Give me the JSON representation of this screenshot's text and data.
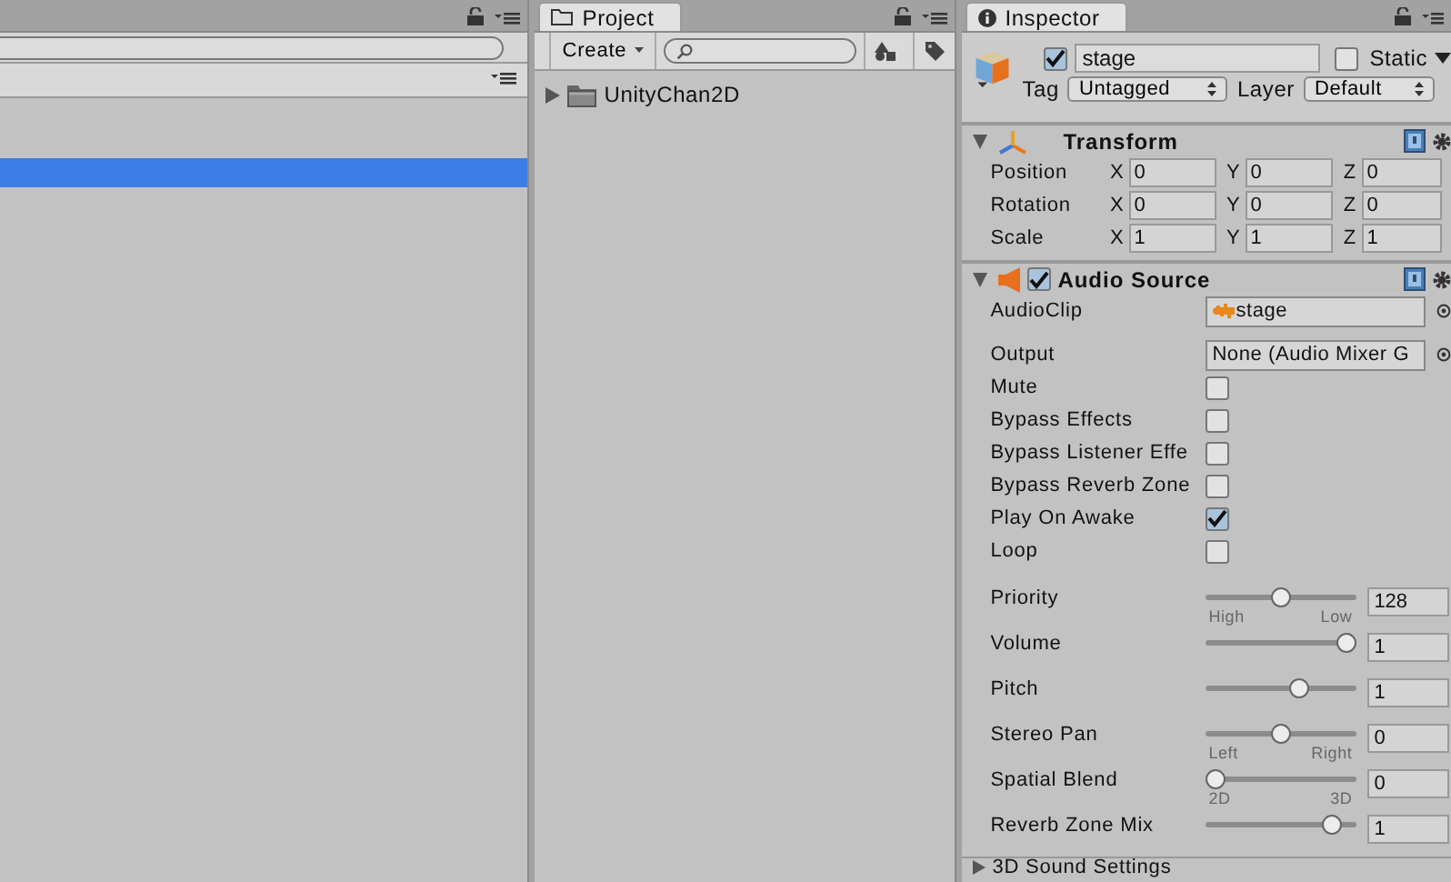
{
  "hierarchy": {
    "rows": [
      {
        "selected": true
      }
    ]
  },
  "project": {
    "tab": "Project",
    "create": "Create",
    "tree": [
      {
        "label": "UnityChan2D",
        "expanded": false
      }
    ]
  },
  "inspector": {
    "tab": "Inspector",
    "object": {
      "active": true,
      "name": "stage",
      "static": false,
      "static_label": "Static",
      "tag_label": "Tag",
      "tag": "Untagged",
      "layer_label": "Layer",
      "layer": "Default"
    },
    "components": [
      {
        "kind": "transform",
        "title": "Transform",
        "expanded": true,
        "rows": [
          {
            "label": "Position",
            "values": [
              {
                "axis": "X",
                "value": "0"
              },
              {
                "axis": "Y",
                "value": "0"
              },
              {
                "axis": "Z",
                "value": "0"
              }
            ]
          },
          {
            "label": "Rotation",
            "values": [
              {
                "axis": "X",
                "value": "0"
              },
              {
                "axis": "Y",
                "value": "0"
              },
              {
                "axis": "Z",
                "value": "0"
              }
            ]
          },
          {
            "label": "Scale",
            "values": [
              {
                "axis": "X",
                "value": "1"
              },
              {
                "axis": "Y",
                "value": "1"
              },
              {
                "axis": "Z",
                "value": "1"
              }
            ]
          }
        ]
      },
      {
        "kind": "audio",
        "title": "Audio Source",
        "enabled": true,
        "expanded": true,
        "properties": [
          {
            "kind": "object",
            "label": "AudioClip",
            "value": "stage",
            "asset": true
          },
          {
            "kind": "object",
            "label": "Output",
            "value": "None (Audio Mixer G",
            "asset": false
          },
          {
            "kind": "toggle",
            "label": "Mute",
            "checked": false
          },
          {
            "kind": "toggle",
            "label": "Bypass Effects",
            "checked": false
          },
          {
            "kind": "toggle",
            "label": "Bypass Listener Effe",
            "checked": false
          },
          {
            "kind": "toggle",
            "label": "Bypass Reverb Zone",
            "checked": false
          },
          {
            "kind": "toggle",
            "label": "Play On Awake",
            "checked": true
          },
          {
            "kind": "toggle",
            "label": "Loop",
            "checked": false
          },
          {
            "kind": "slider",
            "label": "Priority",
            "level": 0.5,
            "value": "128",
            "min_label": "High",
            "max_label": "Low"
          },
          {
            "kind": "slider",
            "label": "Volume",
            "level": 1,
            "value": "1"
          },
          {
            "kind": "slider",
            "label": "Pitch",
            "level": 0.65,
            "value": "1"
          },
          {
            "kind": "slider",
            "label": "Stereo Pan",
            "level": 0.5,
            "value": "0",
            "min_label": "Left",
            "max_label": "Right"
          },
          {
            "kind": "slider",
            "label": "Spatial Blend",
            "level": 0,
            "value": "0",
            "min_label": "2D",
            "max_label": "3D"
          },
          {
            "kind": "slider",
            "label": "Reverb Zone Mix",
            "level": 0.9,
            "value": "1"
          }
        ]
      }
    ],
    "footer": {
      "label": "3D Sound Settings",
      "expanded": false
    }
  }
}
